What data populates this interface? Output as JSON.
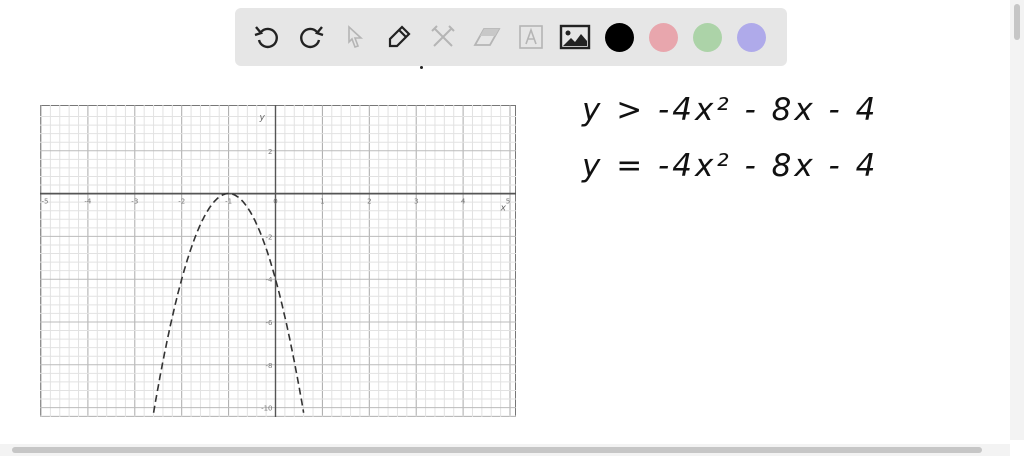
{
  "toolbar": {
    "tools": [
      {
        "name": "undo",
        "icon": "undo-icon",
        "enabled": true
      },
      {
        "name": "redo",
        "icon": "redo-icon",
        "enabled": true
      },
      {
        "name": "select",
        "icon": "cursor-icon",
        "enabled": false
      },
      {
        "name": "pen",
        "icon": "pencil-icon",
        "enabled": true
      },
      {
        "name": "tools",
        "icon": "tools-icon",
        "enabled": false
      },
      {
        "name": "eraser",
        "icon": "eraser-icon",
        "enabled": false
      },
      {
        "name": "text",
        "icon": "text-icon",
        "enabled": false
      },
      {
        "name": "image",
        "icon": "image-icon",
        "enabled": true
      }
    ],
    "colors": [
      "#000000",
      "#e8a6ad",
      "#acd3a8",
      "#afaaea"
    ]
  },
  "equations": {
    "inequality": "y > -4x² - 8x - 4",
    "boundary": "y = -4x² - 8x - 4"
  },
  "chart_data": {
    "type": "line",
    "title": "",
    "xlabel": "x",
    "ylabel": "y",
    "xlim": [
      -5,
      5
    ],
    "ylim": [
      -10.3,
      4
    ],
    "x_ticks": [
      -5,
      -4,
      -3,
      -2,
      -1,
      0,
      1,
      2,
      3,
      4,
      5
    ],
    "x_tick_labels": [
      "-5",
      "-4",
      "-3",
      "-2",
      "-1",
      "0",
      "1",
      "2",
      "3",
      "4",
      "5"
    ],
    "y_ticks": [
      2,
      -2,
      -4,
      -6,
      -8,
      -10
    ],
    "y_tick_labels": [
      "2",
      "-2",
      "-4",
      "-6",
      "-8",
      "-10"
    ],
    "grid": true,
    "series": [
      {
        "name": "y = -4x^2 - 8x - 4",
        "style": "dashed",
        "a": -4,
        "b": -8,
        "c": -4,
        "vertex": [
          -1,
          0
        ],
        "y_intercept": -4
      }
    ]
  }
}
